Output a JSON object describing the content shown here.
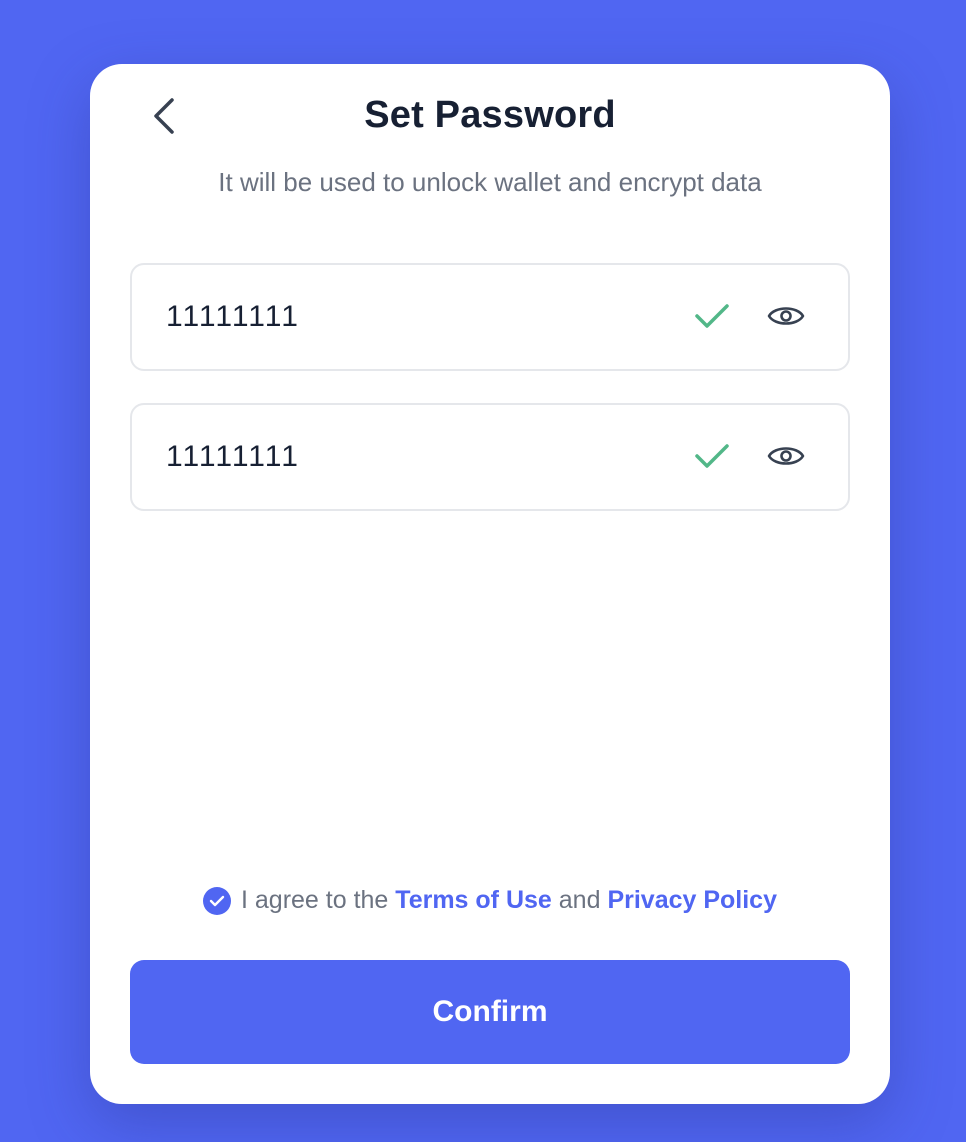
{
  "header": {
    "back_icon": "chevron-left-icon",
    "title": "Set Password",
    "subtitle": "It will be used to unlock wallet and encrypt data"
  },
  "fields": [
    {
      "value": "11111111",
      "status_icon": "check-icon",
      "toggle_icon": "eye-icon"
    },
    {
      "value": "11111111",
      "status_icon": "check-icon",
      "toggle_icon": "eye-icon"
    }
  ],
  "agreement": {
    "checked": true,
    "prefix": "I agree to the",
    "terms_label": "Terms of Use",
    "conjunction": "and",
    "privacy_label": "Privacy Policy"
  },
  "confirm_label": "Confirm",
  "colors": {
    "background": "#5066f2",
    "accent": "#5066f2",
    "success": "#52b788",
    "title": "#172033",
    "muted": "#6b7280"
  }
}
